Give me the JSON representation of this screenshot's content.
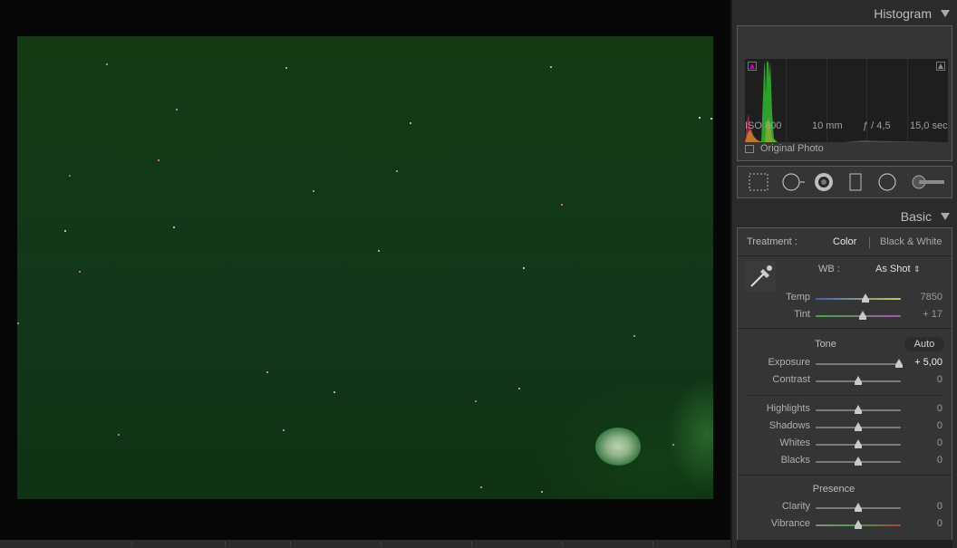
{
  "histogram": {
    "title": "Histogram",
    "iso": "ISO 800",
    "focal_length": "10 mm",
    "aperture": "ƒ / 4,5",
    "shutter": "15,0 sec",
    "original_photo_label": "Original Photo",
    "clip_shadow_color": "#b000b0"
  },
  "tools": [
    "crop-overlay-icon",
    "spot-removal-icon",
    "red-eye-icon",
    "graduated-filter-icon",
    "radial-filter-icon",
    "adjustment-brush-icon"
  ],
  "basic": {
    "title": "Basic",
    "treatment_label": "Treatment :",
    "treatment_color": "Color",
    "treatment_bw": "Black & White",
    "wb_label": "WB :",
    "wb_value": "As Shot",
    "sliders_wb": [
      {
        "label": "Temp",
        "value": "7850",
        "position": 0.58
      },
      {
        "label": "Tint",
        "value": "+ 17",
        "position": 0.55
      }
    ],
    "tone_label": "Tone",
    "auto_label": "Auto",
    "sliders_tone": [
      {
        "label": "Exposure",
        "value": "+ 5,00",
        "position": 0.98
      },
      {
        "label": "Contrast",
        "value": "0",
        "position": 0.5
      }
    ],
    "sliders_light": [
      {
        "label": "Highlights",
        "value": "0",
        "position": 0.5
      },
      {
        "label": "Shadows",
        "value": "0",
        "position": 0.5
      },
      {
        "label": "Whites",
        "value": "0",
        "position": 0.5
      },
      {
        "label": "Blacks",
        "value": "0",
        "position": 0.5
      }
    ],
    "presence_label": "Presence",
    "sliders_presence": [
      {
        "label": "Clarity",
        "value": "0",
        "position": 0.5
      },
      {
        "label": "Vibrance",
        "value": "0",
        "position": 0.5
      }
    ]
  }
}
